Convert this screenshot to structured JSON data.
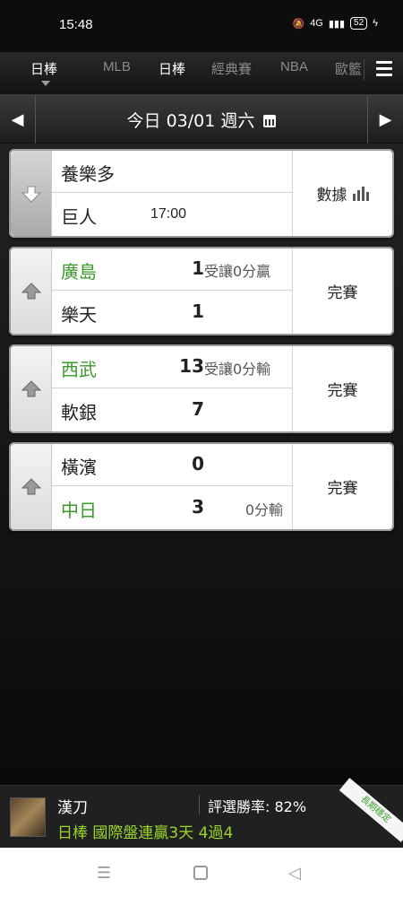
{
  "status_bar": {
    "time": "15:48",
    "signal_text": "4G",
    "battery": "52"
  },
  "tabs": {
    "current": "日棒",
    "items": [
      "MLB",
      "日棒",
      "經典賽",
      "NBA",
      "歐籃"
    ]
  },
  "date_bar": {
    "label": "今日 03/01 週六"
  },
  "games": [
    {
      "home": "養樂多",
      "away": "巨人",
      "time": "17:00",
      "status": "數據"
    },
    {
      "team1": "廣島",
      "score1": "1",
      "odds": "受讓0分贏",
      "team2": "樂天",
      "score2": "1",
      "status": "完賽"
    },
    {
      "team1": "西武",
      "score1": "13",
      "odds": "受讓0分輸",
      "team2": "軟銀",
      "score2": "7",
      "status": "完賽"
    },
    {
      "team1": "橫濱",
      "score1": "0",
      "team2": "中日",
      "score2": "3",
      "odds": "0分輸",
      "status": "完賽"
    }
  ],
  "promo": {
    "author": "漢刀",
    "rate": "評選勝率: 82%",
    "headline": "日棒 國際盤連贏3天 4過4",
    "ribbon": "長期穩定"
  },
  "colors": {
    "accent_green": "#3a9a2a",
    "promo_green": "#9ad62a"
  }
}
